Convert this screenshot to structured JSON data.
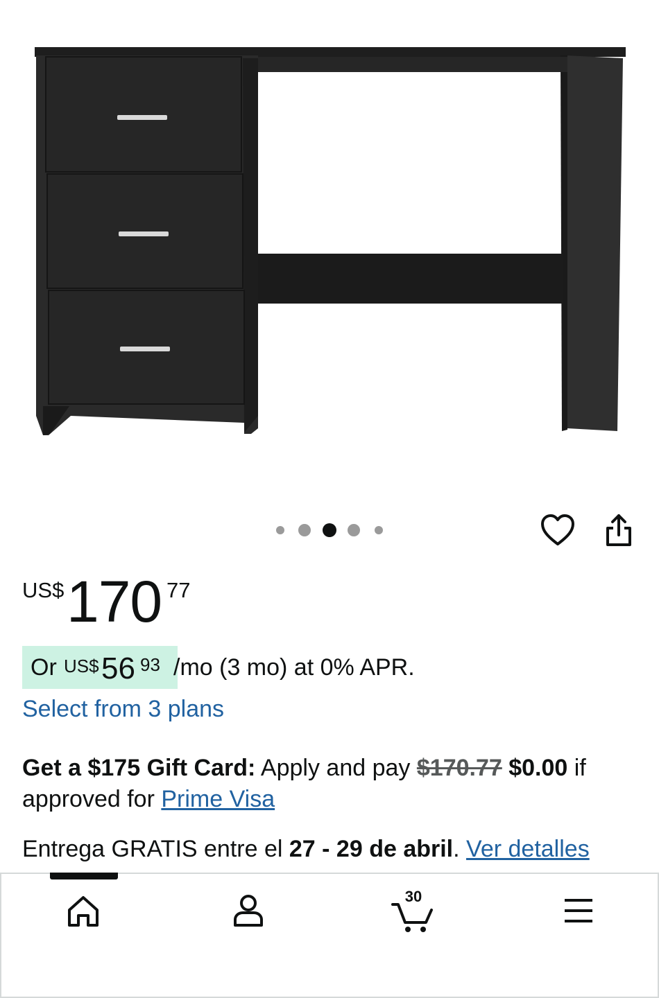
{
  "product": {
    "image_alt": "Black office desk with three drawers",
    "gallery": {
      "count": 5,
      "active_index": 2
    }
  },
  "icons": {
    "favorite": "heart-icon",
    "share": "share-icon",
    "home": "home-icon",
    "account": "person-icon",
    "cart": "cart-icon",
    "menu": "hamburger-menu-icon"
  },
  "price": {
    "currency": "US$",
    "whole": "170",
    "fraction": "77"
  },
  "installment": {
    "prefix": "Or",
    "currency": "US$",
    "whole": "56",
    "fraction": "93",
    "suffix": "/mo (3 mo) at 0% APR."
  },
  "plans_link": "Select from 3 plans",
  "gift_card": {
    "bold_lead": "Get a $175 Gift Card:",
    "text1": "Apply and pay",
    "old_price": "$170.77",
    "new_price": "$0.00",
    "text2": "if approved for",
    "link": "Prime Visa"
  },
  "delivery": {
    "text1": "Entrega GRATIS entre el",
    "dates": "27 - 29 de abril",
    "period": ".",
    "link": "Ver detalles"
  },
  "nav": {
    "cart_count": "30"
  },
  "colors": {
    "link": "#2162a1",
    "installment_badge": "#cdf2e3",
    "desk": "#2a2a2a"
  }
}
